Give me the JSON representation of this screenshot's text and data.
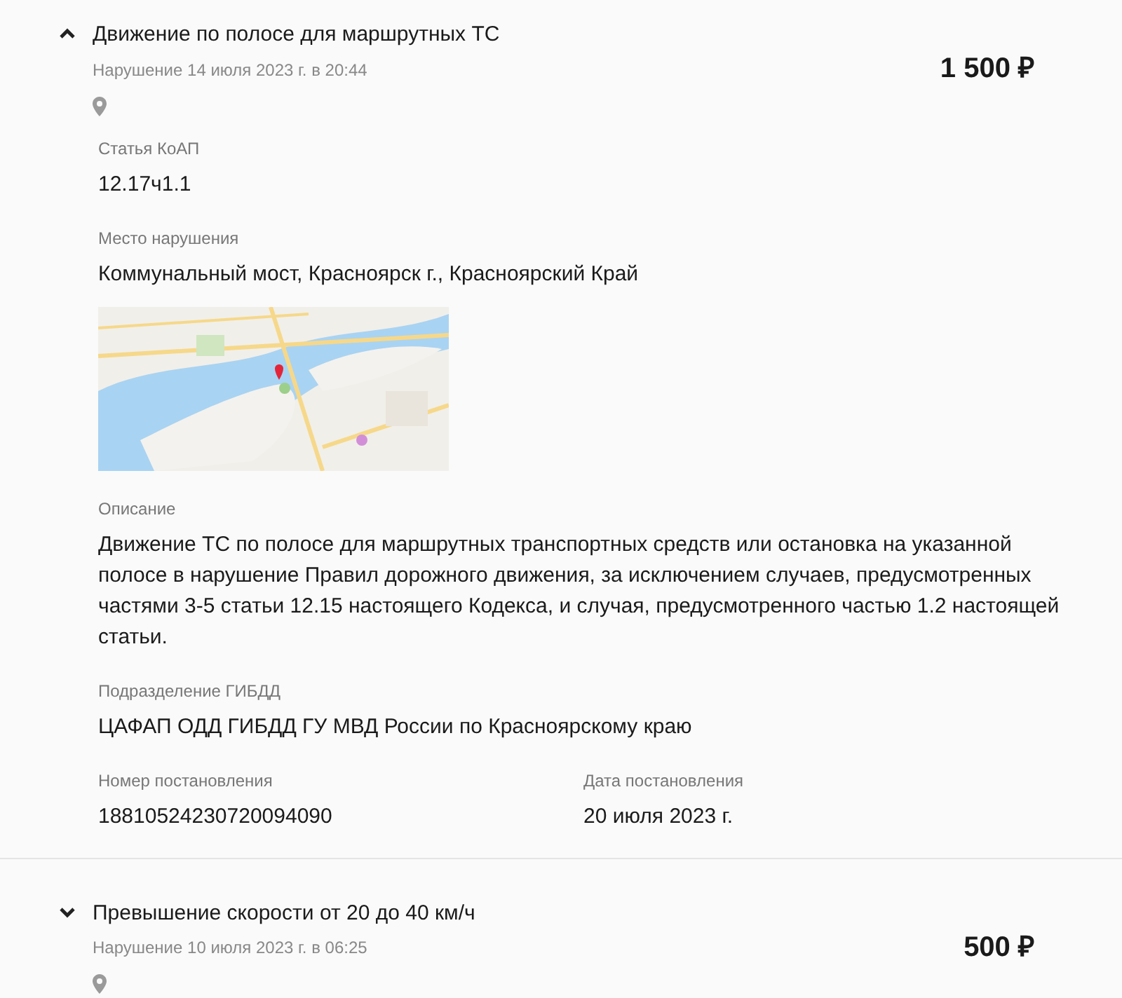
{
  "fines": [
    {
      "title": "Движение по полосе для маршрутных ТС",
      "date": "Нарушение 14 июля 2023 г. в 20:44",
      "amount": "1 500 ₽",
      "expanded": true,
      "details": {
        "article": {
          "label": "Статья КоАП",
          "value": "12.17ч1.1"
        },
        "place": {
          "label": "Место нарушения",
          "value": "Коммунальный мост, Красноярск г., Красноярский Край"
        },
        "description": {
          "label": "Описание",
          "value": "Движение ТС по полосе для маршрутных транспортных средств или остановка на указанной полосе в нарушение Правил дорожного движения, за исключением случаев, предусмотренных частями 3-5 статьи 12.15 настоящего Кодекса, и случая, предусмотренного частью 1.2 настоящей статьи."
        },
        "department": {
          "label": "Подразделение ГИБДД",
          "value": "ЦАФАП ОДД ГИБДД ГУ МВД России по Красноярскому краю"
        },
        "decree_number": {
          "label": "Номер постановления",
          "value": "18810524230720094090"
        },
        "decree_date": {
          "label": "Дата постановления",
          "value": "20 июля 2023 г."
        }
      }
    },
    {
      "title": "Превышение скорости от 20 до 40 км/ч",
      "date": "Нарушение 10 июля 2023 г. в 06:25",
      "amount": "500 ₽",
      "expanded": false
    }
  ]
}
